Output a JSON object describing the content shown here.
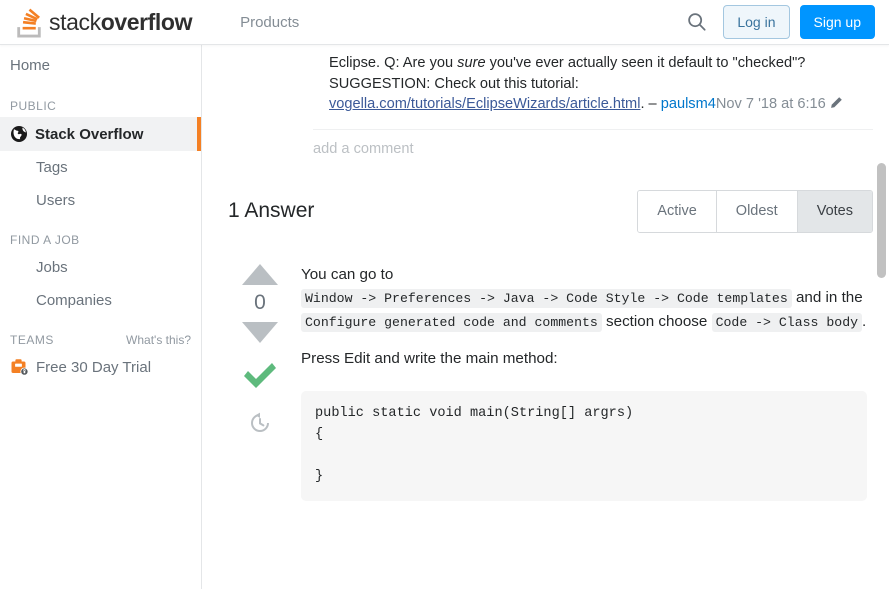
{
  "header": {
    "logo_text_light": "stack",
    "logo_text_bold": "overflow",
    "logo_icon": "stackoverflow-logo-icon",
    "nav_products": "Products",
    "search_icon": "search-icon",
    "login_label": "Log in",
    "signup_label": "Sign up",
    "signup_color": "#0095ff",
    "login_color": "#39739d"
  },
  "sidebar": {
    "home_label": "Home",
    "public_heading": "PUBLIC",
    "public_items": [
      {
        "label": "Stack Overflow",
        "icon": "globe-icon",
        "active": true
      },
      {
        "label": "Tags",
        "icon": "",
        "active": false
      },
      {
        "label": "Users",
        "icon": "",
        "active": false
      }
    ],
    "jobs_heading": "FIND A JOB",
    "jobs_items": [
      {
        "label": "Jobs"
      },
      {
        "label": "Companies"
      }
    ],
    "teams_heading": "TEAMS",
    "teams_whats_this": "What's this?",
    "teams_trial_label": "Free 30 Day Trial",
    "teams_trial_icon": "briefcase-lock-icon",
    "active_indicator_color": "#f48024"
  },
  "comment": {
    "text_line1": "Eclipse. Q: Are you ",
    "emphasis": "sure",
    "text_line2": " you've ever actually seen it default to \"checked\"? SUGGESTION: Check out this tutorial: ",
    "link_text": "vogella.com/tutorials/EclipseWizards/article.html",
    "after_link": ". – ",
    "user": "paulsm4",
    "date": "Nov 7 '18 at 6:16",
    "edit_icon": "pencil-icon"
  },
  "add_comment_label": "add a comment",
  "answers": {
    "title": "1 Answer",
    "sort_tabs": [
      {
        "label": "Active",
        "selected": false
      },
      {
        "label": "Oldest",
        "selected": false
      },
      {
        "label": "Votes",
        "selected": true
      }
    ]
  },
  "answer": {
    "vote_count": "0",
    "upvote_icon": "arrow-up-icon",
    "downvote_icon": "arrow-down-icon",
    "accepted_icon": "checkmark-icon",
    "accepted_color": "#5eba7d",
    "history_icon": "history-clock-icon",
    "para1_a": "You can go to ",
    "code1": "Window -> Preferences -> Java -> Code Style -> Code templates",
    "para1_b": " and in the ",
    "code2": "Configure generated code and comments",
    "para1_c": " section choose ",
    "code3": "Code -> Class body",
    "para1_d": ".",
    "para2": "Press Edit and write the main method:",
    "code_block": "public static void main(String[] argrs)\n{\n\n}"
  },
  "scrollbar": {
    "thumb_color": "#c1c1c1"
  }
}
